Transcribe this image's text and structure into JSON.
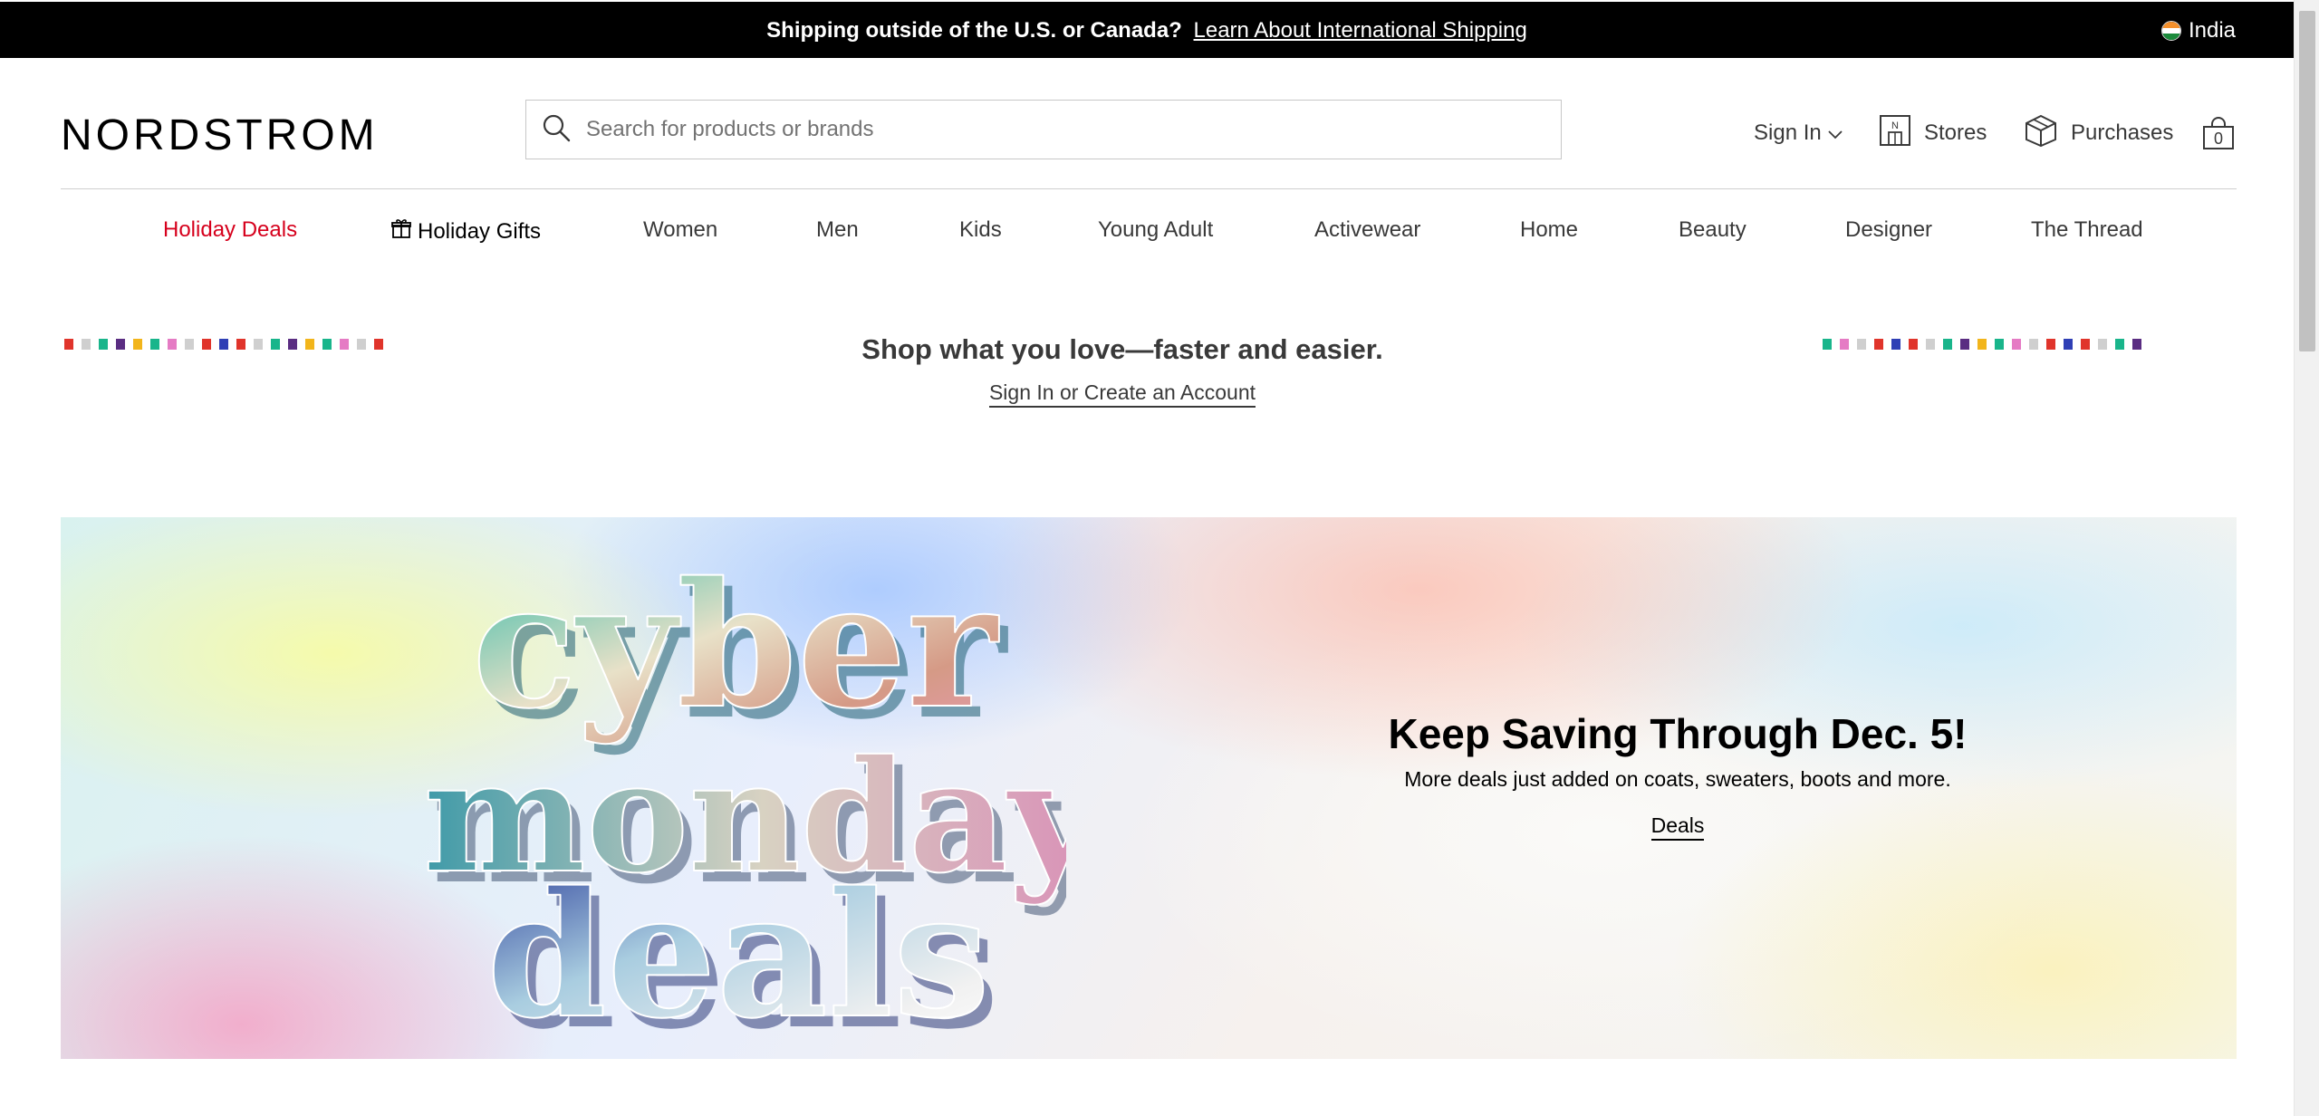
{
  "banner": {
    "message": "Shipping outside of the U.S. or Canada?",
    "link": "Learn About International Shipping",
    "country": "India"
  },
  "header": {
    "logo": "NORDSTROM",
    "search_placeholder": "Search for products or brands",
    "sign_in": "Sign In",
    "stores": "Stores",
    "purchases": "Purchases",
    "bag_count": "0"
  },
  "nav": {
    "items": [
      "Holiday Deals",
      "Holiday Gifts",
      "Women",
      "Men",
      "Kids",
      "Young Adult",
      "Activewear",
      "Home",
      "Beauty",
      "Designer",
      "The Thread"
    ]
  },
  "promo": {
    "title": "Shop what you love—faster and easier.",
    "link": "Sign In or Create an Account"
  },
  "hero": {
    "art_line_1": "cyber",
    "art_line_2": "monday",
    "art_line_3": "deals",
    "title": "Keep Saving Through Dec. 5!",
    "subtitle": "More deals just added on coats, sweaters, boots and more.",
    "cta": "Deals"
  },
  "colors": {
    "deal_red": "#d6001c",
    "dot_palette": [
      "#e0342b",
      "#cfcfcf",
      "#19b58b",
      "#5a2d82",
      "#f2b51b",
      "#19b58b",
      "#e57bc4",
      "#cfcfcf",
      "#e0342b",
      "#2f3fb5",
      "#e0342b"
    ]
  }
}
